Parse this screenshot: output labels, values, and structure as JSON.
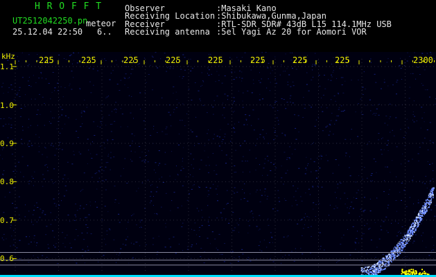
{
  "header": {
    "program": "H R O F F T",
    "filename": "UT2512042250.pn",
    "meteor_label": "meteor",
    "datetime": "25.12.04 22:50",
    "extra": "6..",
    "fields": [
      {
        "label": "Observer",
        "value": ":Masaki Kano"
      },
      {
        "label": "Receiving Location",
        "value": ":Shibukawa,Gunma,Japan"
      },
      {
        "label": "Receiver",
        "value": ":RTL-SDR SDR# 43dB L15 114.1MHz USB"
      },
      {
        "label": "Receiving antenna",
        "value": ":5el Yagi Az 20 for Aomori VOR"
      }
    ]
  },
  "chart_data": {
    "type": "heatmap",
    "ylabel": "kHz",
    "x_tick_labels": [
      "225",
      "225",
      "225",
      "225",
      "225",
      "225",
      "225",
      "225",
      "2300"
    ],
    "y_tick_labels": [
      "1.1",
      "1.0",
      "0.9",
      "0.8",
      "0.7",
      "0.6"
    ],
    "y_ticks": [
      1.1,
      1.0,
      0.9,
      0.8,
      0.7,
      0.6
    ],
    "ylim": [
      0.57,
      1.12
    ],
    "colors": {
      "background": "#000010",
      "noise": "#1a2aa0",
      "signal": "#6a8aff",
      "hot": "#ffff00",
      "grid": "#2a2a3a",
      "axis": "#f0f000",
      "baseline": "#00e0ff"
    }
  }
}
